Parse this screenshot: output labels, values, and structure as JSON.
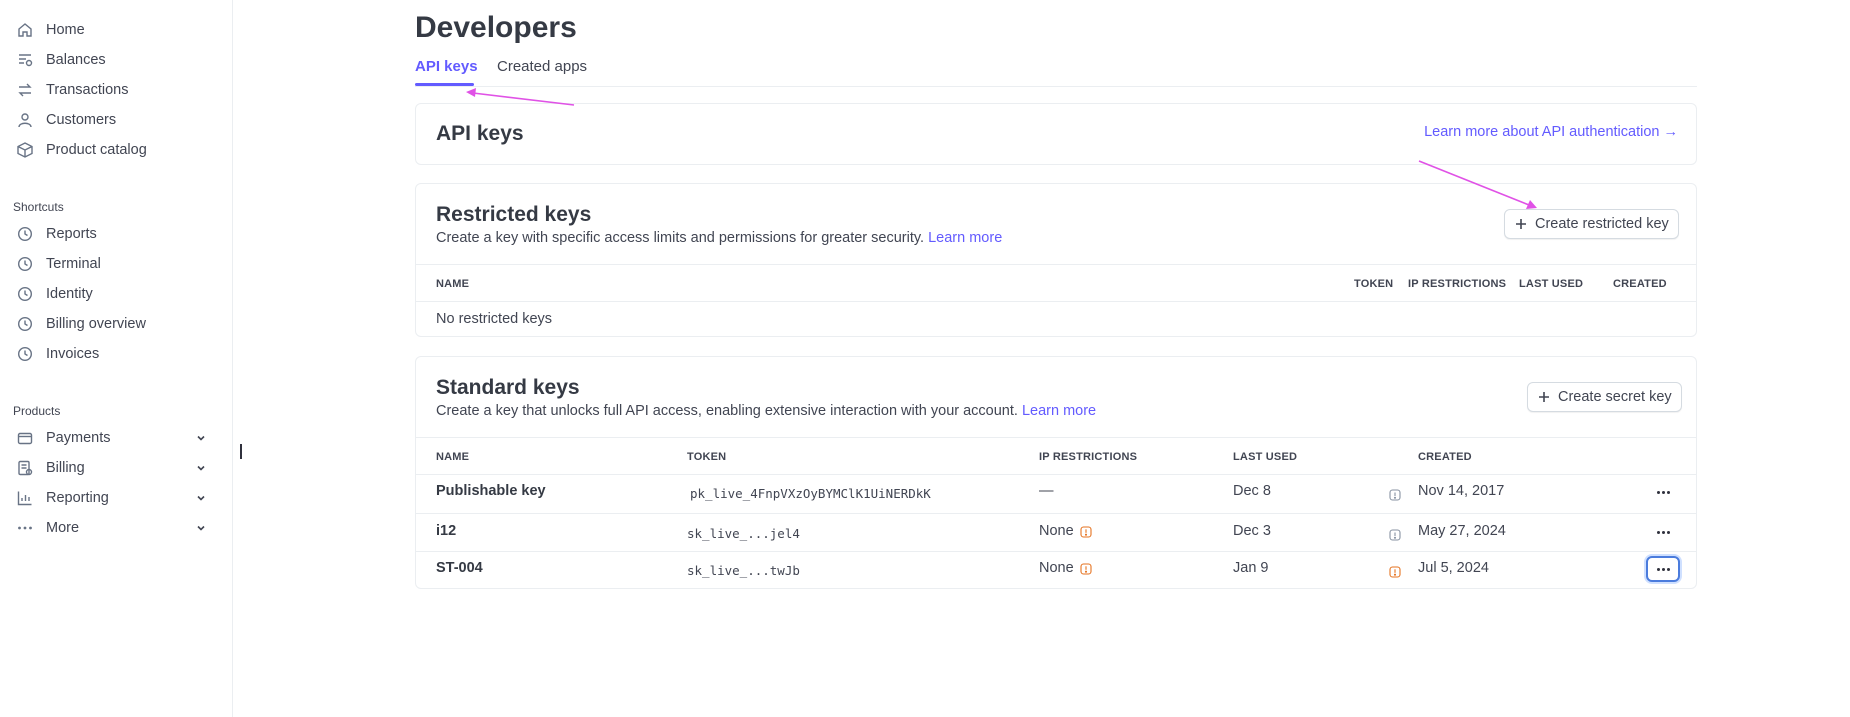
{
  "sidebar": {
    "items": [
      {
        "label": "Home",
        "icon": "home-icon"
      },
      {
        "label": "Balances",
        "icon": "balances-icon"
      },
      {
        "label": "Transactions",
        "icon": "transactions-icon"
      },
      {
        "label": "Customers",
        "icon": "customers-icon"
      },
      {
        "label": "Product catalog",
        "icon": "product-catalog-icon"
      }
    ],
    "shortcuts_label": "Shortcuts",
    "shortcuts": [
      {
        "label": "Reports",
        "icon": "clock-icon"
      },
      {
        "label": "Terminal",
        "icon": "clock-icon"
      },
      {
        "label": "Identity",
        "icon": "clock-icon"
      },
      {
        "label": "Billing overview",
        "icon": "clock-icon"
      },
      {
        "label": "Invoices",
        "icon": "clock-icon"
      }
    ],
    "products_label": "Products",
    "products": [
      {
        "label": "Payments",
        "icon": "payments-icon"
      },
      {
        "label": "Billing",
        "icon": "billing-icon"
      },
      {
        "label": "Reporting",
        "icon": "reporting-icon"
      },
      {
        "label": "More",
        "icon": "more-dots-icon"
      }
    ]
  },
  "header": {
    "title": "Developers",
    "tabs": [
      {
        "label": "API keys",
        "active": true
      },
      {
        "label": "Created apps",
        "active": false
      }
    ]
  },
  "api_keys_card": {
    "title": "API keys",
    "learn_more_link": "Learn more about API authentication →"
  },
  "restricted": {
    "title": "Restricted keys",
    "description": "Create a key with specific access limits and permissions for greater security.",
    "learn_more": "Learn more",
    "create_button": "Create restricted key",
    "columns": [
      "NAME",
      "TOKEN",
      "IP RESTRICTIONS",
      "LAST USED",
      "CREATED"
    ],
    "empty_text": "No restricted keys"
  },
  "standard": {
    "title": "Standard keys",
    "description": "Create a key that unlocks full API access, enabling extensive interaction with your account.",
    "learn_more": "Learn more",
    "create_button": "Create secret key",
    "columns": [
      "NAME",
      "TOKEN",
      "IP RESTRICTIONS",
      "LAST USED",
      "CREATED"
    ],
    "rows": [
      {
        "name": "Publishable key",
        "token": "pk_live_4FnpVXzOyBYMClK1UiNERDkK",
        "ip": "—",
        "last_used": "Dec 8",
        "created": "Nov 14, 2017"
      },
      {
        "name": "i12",
        "token": "sk_live_...jel4",
        "ip": "None",
        "last_used": "Dec 3",
        "created": "May 27, 2024"
      },
      {
        "name": "ST-004",
        "token": "sk_live_...twJb",
        "ip": "None",
        "last_used": "Jan 9",
        "created": "Jul 5, 2024"
      }
    ]
  },
  "colors": {
    "accent": "#635bff",
    "annotation_arrow": "#e052e6",
    "warning_icon": "#e5721f",
    "focus_ring": "#4b7cdd"
  }
}
